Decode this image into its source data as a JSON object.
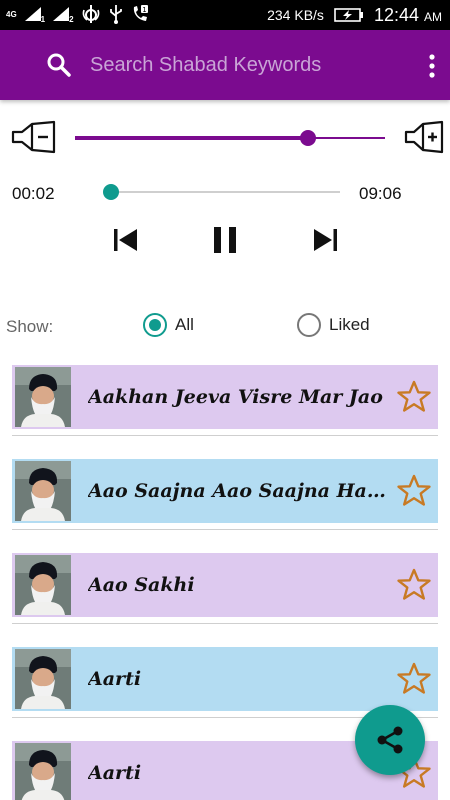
{
  "status_bar": {
    "network_left": "4G",
    "sim1": "1",
    "sim2": "2",
    "speed": "234 KB/s",
    "time": "12:44",
    "ampm": "AM"
  },
  "app_bar": {
    "search_placeholder": "Search Shabad Keywords",
    "background": "#7b0b8f"
  },
  "volume": {
    "level": 0.75
  },
  "player": {
    "current_time": "00:02",
    "total_time": "09:06",
    "progress": 0.004,
    "state": "playing"
  },
  "filter": {
    "label": "Show:",
    "options": [
      {
        "label": "All",
        "selected": true
      },
      {
        "label": "Liked",
        "selected": false
      }
    ]
  },
  "shabads": [
    {
      "title": "Aakhan Jeeva Visre Mar Jao",
      "bg": "#ddc9ef",
      "starred": false
    },
    {
      "title": "Aao Saajna Aao Saajna Hao Dekhan Darshan",
      "bg": "#b3dcf2",
      "starred": false
    },
    {
      "title": "Aao Sakhi",
      "bg": "#ddc9ef",
      "starred": false
    },
    {
      "title": "Aarti",
      "bg": "#b3dcf2",
      "starred": false
    },
    {
      "title": "Aarti",
      "bg": "#ddc9ef",
      "starred": false
    }
  ],
  "colors": {
    "accent": "#0f9b8e",
    "star_outline": "#c87a24"
  },
  "icons": {
    "search": "search-icon",
    "menu": "more-vert-icon",
    "volume_down": "volume-down-icon",
    "volume_up": "volume-up-icon",
    "previous": "skip-previous-icon",
    "pause": "pause-icon",
    "next": "skip-next-icon",
    "star": "star-outline-icon",
    "share": "share-icon"
  }
}
